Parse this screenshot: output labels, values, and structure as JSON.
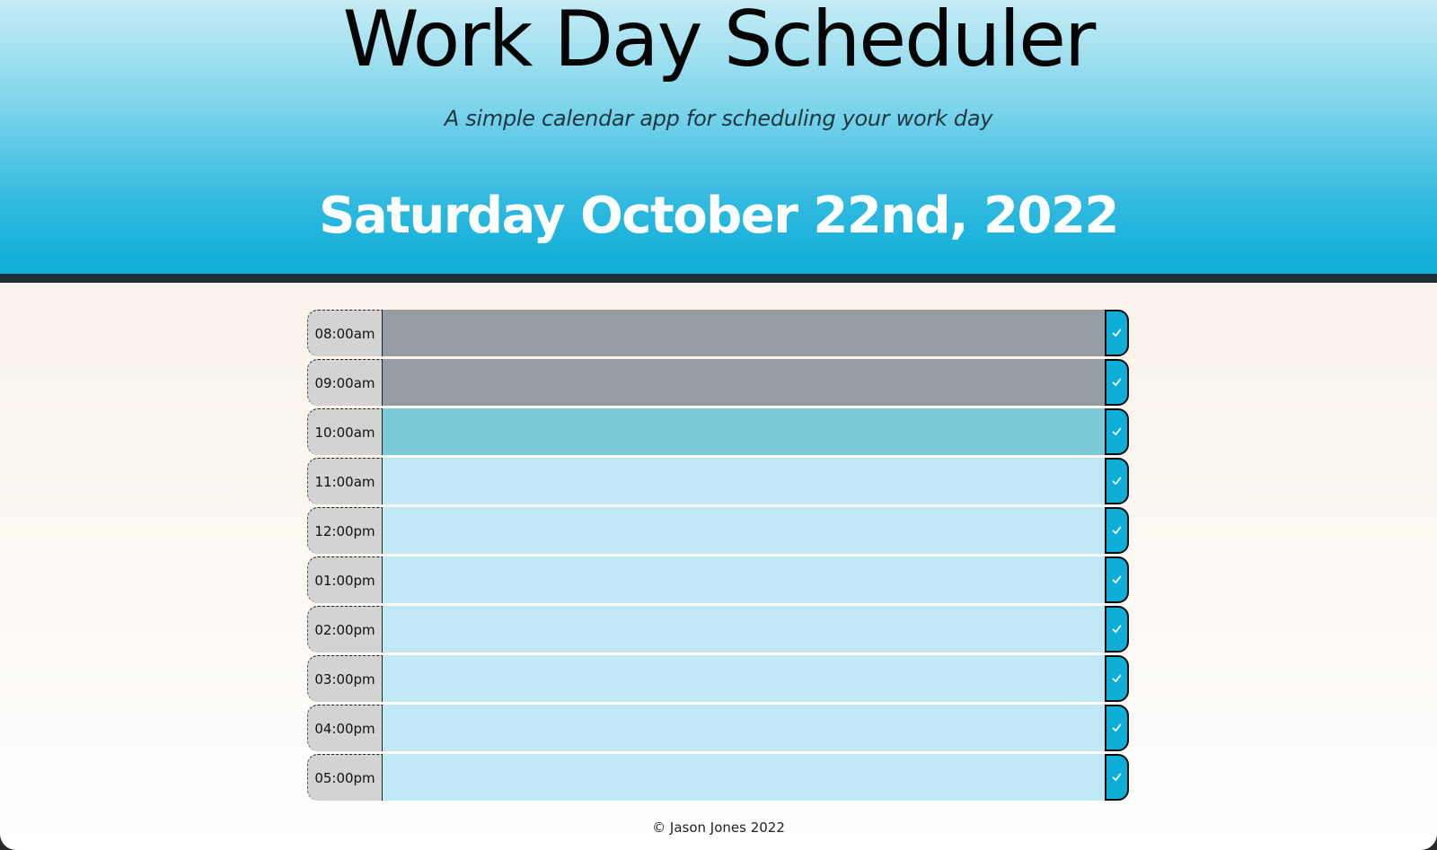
{
  "header": {
    "title": "Work Day Scheduler",
    "subtitle": "A simple calendar app for scheduling your work day",
    "current_day": "Saturday October 22nd, 2022"
  },
  "schedule": {
    "rows": [
      {
        "hour": "08:00am",
        "status": "past",
        "text": ""
      },
      {
        "hour": "09:00am",
        "status": "past",
        "text": ""
      },
      {
        "hour": "10:00am",
        "status": "present",
        "text": ""
      },
      {
        "hour": "11:00am",
        "status": "future",
        "text": ""
      },
      {
        "hour": "12:00pm",
        "status": "future",
        "text": ""
      },
      {
        "hour": "01:00pm",
        "status": "future",
        "text": ""
      },
      {
        "hour": "02:00pm",
        "status": "future",
        "text": ""
      },
      {
        "hour": "03:00pm",
        "status": "future",
        "text": ""
      },
      {
        "hour": "04:00pm",
        "status": "future",
        "text": ""
      },
      {
        "hour": "05:00pm",
        "status": "future",
        "text": ""
      }
    ],
    "save_icon": "check-icon"
  },
  "footer": {
    "text": "© Jason Jones 2022"
  },
  "colors": {
    "past": "#979ea3",
    "present": "#7ccad8",
    "future": "#c1e8f5",
    "accent": "#0daed8",
    "header_rule": "#1e2e3a"
  }
}
